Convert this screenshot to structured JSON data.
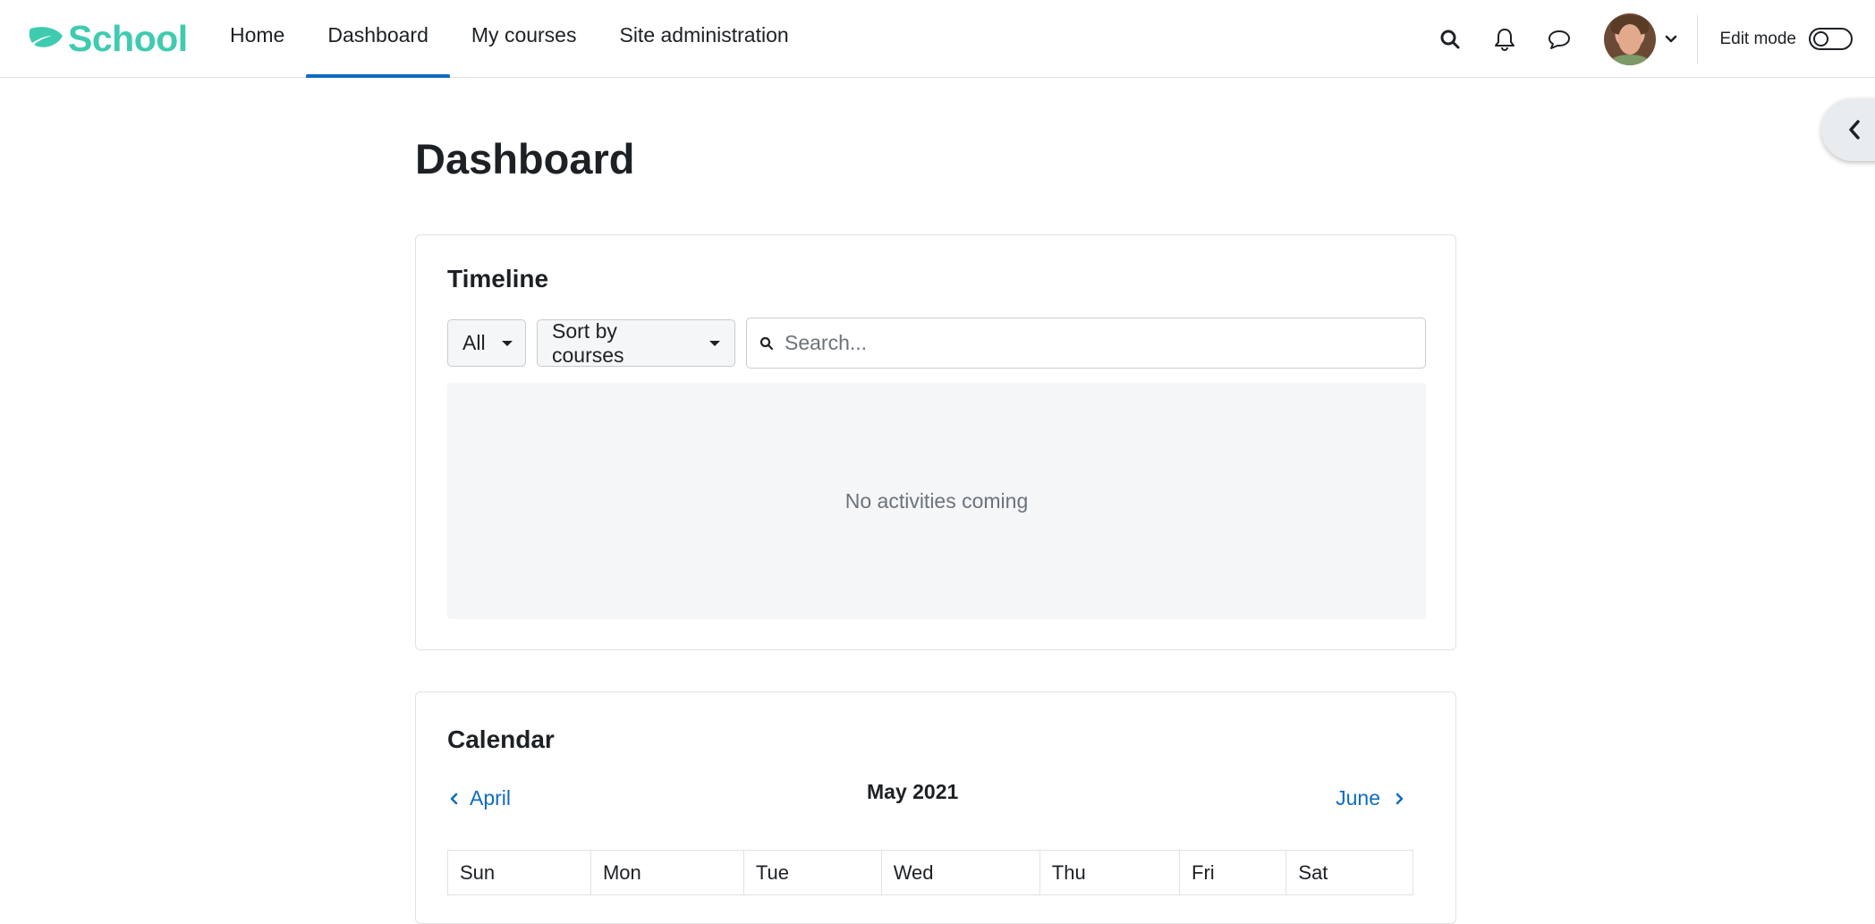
{
  "brand": {
    "name": "School",
    "color": "#3fcbb0"
  },
  "nav": {
    "links": [
      {
        "label": "Home",
        "active": false
      },
      {
        "label": "Dashboard",
        "active": true
      },
      {
        "label": "My courses",
        "active": false
      },
      {
        "label": "Site administration",
        "active": false
      }
    ],
    "accent": "#0f6cbf"
  },
  "header_actions": {
    "search_icon": "search-icon",
    "notifications_icon": "bell-icon",
    "messages_icon": "chat-bubble-icon",
    "user_menu_icon": "chevron-down-icon",
    "edit_mode_label": "Edit mode",
    "edit_mode_on": false
  },
  "page": {
    "title": "Dashboard"
  },
  "timeline": {
    "title": "Timeline",
    "filter_selected": "All",
    "sort_selected": "Sort by courses",
    "search_placeholder": "Search...",
    "search_value": "",
    "empty_message": "No activities coming"
  },
  "calendar": {
    "title": "Calendar",
    "prev_label": "April",
    "current_month": "May 2021",
    "next_label": "June",
    "weekdays": [
      "Sun",
      "Mon",
      "Tue",
      "Wed",
      "Thu",
      "Fri",
      "Sat"
    ]
  }
}
